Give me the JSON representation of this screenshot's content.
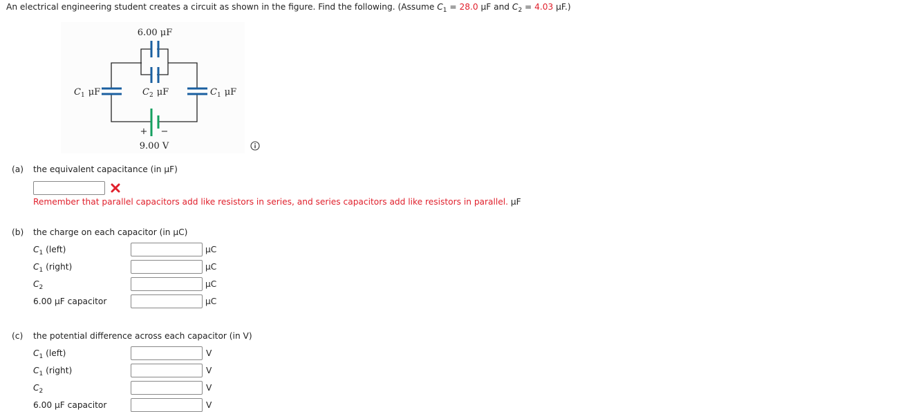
{
  "problem": {
    "intro": "An electrical engineering student creates a circuit as shown in the figure. Find the following. (Assume ",
    "c1_symbol": "C",
    "c1_sub": "1",
    "eq1": " = ",
    "c1_value": "28.0",
    "unit_uF": " μF and ",
    "c2_symbol": "C",
    "c2_sub": "2",
    "eq2": " = ",
    "c2_value": "4.03",
    "tail": " μF.)"
  },
  "figure": {
    "top_cap_label": "6.00 μF",
    "left_cap_label": "C",
    "left_cap_sub": "1",
    "left_cap_unit": "μF",
    "mid_cap_label": "C",
    "mid_cap_sub": "2",
    "mid_cap_unit": "μF",
    "right_cap_label": "C",
    "right_cap_sub": "1",
    "right_cap_unit": "μF",
    "battery_plus": "+",
    "battery_minus": "−",
    "battery_label": "9.00 V",
    "capacitor_color": "#1a5fa0",
    "battery_color": "#15a060"
  },
  "part_a": {
    "label": "(a)",
    "question": "the equivalent capacitance (in μF)",
    "answer_value": "",
    "status": "incorrect",
    "feedback": "Remember that parallel capacitors add like resistors in series, and series capacitors add like resistors in parallel.",
    "unit": "μF"
  },
  "part_b": {
    "label": "(b)",
    "question": "the charge on each capacitor (in μC)",
    "rows": [
      {
        "sym": "C",
        "sub": "1",
        "suffix": " (left)",
        "value": "",
        "unit": "μC"
      },
      {
        "sym": "C",
        "sub": "1",
        "suffix": " (right)",
        "value": "",
        "unit": "μC"
      },
      {
        "sym": "C",
        "sub": "2",
        "suffix": "",
        "value": "",
        "unit": "μC"
      },
      {
        "sym": "",
        "sub": "",
        "suffix": "6.00 μF capacitor",
        "value": "",
        "unit": "μC"
      }
    ]
  },
  "part_c": {
    "label": "(c)",
    "question": "the potential difference across each capacitor (in V)",
    "rows": [
      {
        "sym": "C",
        "sub": "1",
        "suffix": " (left)",
        "value": "",
        "unit": "V"
      },
      {
        "sym": "C",
        "sub": "1",
        "suffix": " (right)",
        "value": "",
        "unit": "V"
      },
      {
        "sym": "C",
        "sub": "2",
        "suffix": "",
        "value": "",
        "unit": "V"
      },
      {
        "sym": "",
        "sub": "",
        "suffix": "6.00 μF capacitor",
        "value": "",
        "unit": "V"
      }
    ]
  },
  "icons": {
    "incorrect": "x-mark-icon",
    "info": "info-icon"
  }
}
